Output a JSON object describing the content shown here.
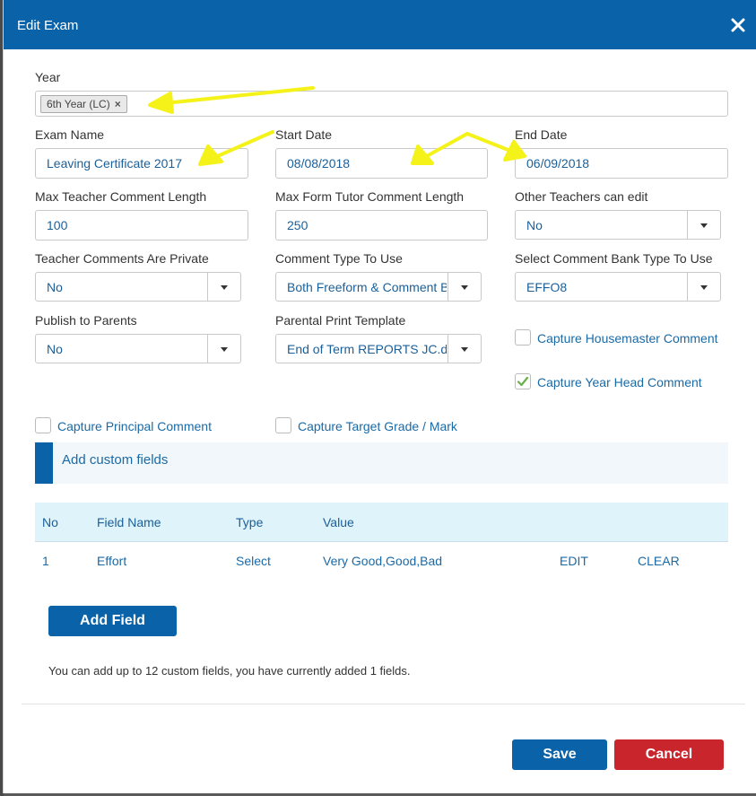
{
  "dialog": {
    "title": "Edit Exam"
  },
  "year": {
    "label": "Year",
    "tag": "6th Year (LC)"
  },
  "exam_name": {
    "label": "Exam Name",
    "value": "Leaving Certificate 2017"
  },
  "start_date": {
    "label": "Start Date",
    "value": "08/08/2018"
  },
  "end_date": {
    "label": "End Date",
    "value": "06/09/2018"
  },
  "max_teacher_comment": {
    "label": "Max Teacher Comment Length",
    "value": "100"
  },
  "max_form_tutor_comment": {
    "label": "Max Form Tutor Comment Length",
    "value": "250"
  },
  "other_teachers_edit": {
    "label": "Other Teachers can edit",
    "value": "No"
  },
  "teacher_comments_private": {
    "label": "Teacher Comments Are Private",
    "value": "No"
  },
  "comment_type": {
    "label": "Comment Type To Use",
    "value": "Both Freeform & Comment Bank"
  },
  "comment_bank_type": {
    "label": "Select Comment Bank Type To Use",
    "value": "EFFO8"
  },
  "publish_parents": {
    "label": "Publish to Parents",
    "value": "No"
  },
  "print_template": {
    "label": "Parental Print Template",
    "value": "End of Term REPORTS JC.docx"
  },
  "checkboxes": {
    "housemaster": {
      "label": "Capture Housemaster Comment",
      "checked": false
    },
    "year_head": {
      "label": "Capture Year Head Comment",
      "checked": true
    },
    "principal": {
      "label": "Capture Principal Comment",
      "checked": false
    },
    "target_grade": {
      "label": "Capture Target Grade / Mark",
      "checked": false
    }
  },
  "custom_fields": {
    "title": "Add custom fields",
    "columns": {
      "no": "No",
      "field_name": "Field Name",
      "type": "Type",
      "value": "Value"
    },
    "rows": [
      {
        "no": "1",
        "field_name": "Effort",
        "type": "Select",
        "value": "Very Good,Good,Bad",
        "edit": "EDIT",
        "clear": "CLEAR"
      }
    ],
    "add_button": "Add Field",
    "info": "You can add up to 12 custom fields, you have currently added 1 fields."
  },
  "footer": {
    "save": "Save",
    "cancel": "Cancel"
  },
  "colors": {
    "header": "#0a63a8",
    "primary_button": "#0a63a8",
    "cancel_button": "#c9252c",
    "annotation_arrow": "#f5f21a",
    "checkmark": "#6ab04c"
  },
  "icons": {
    "close": "close-icon",
    "caret": "caret-down-icon",
    "tag_remove": "remove-tag-icon"
  }
}
